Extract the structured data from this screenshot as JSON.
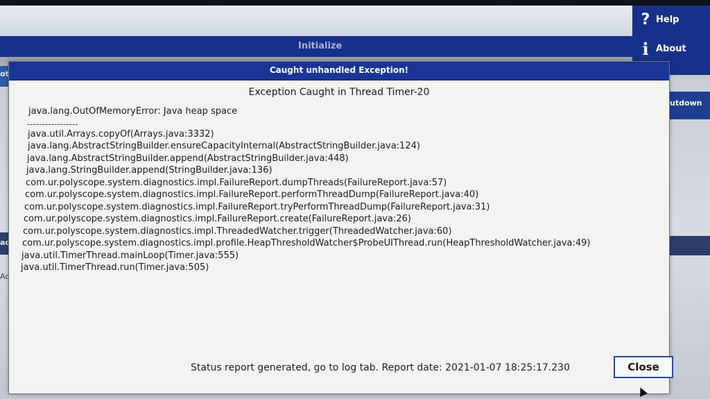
{
  "background": {
    "initialize_label": "Initialize",
    "left_fragment_top": "ot St",
    "left_fragment_mid": "ad",
    "left_fragment_low": "Act",
    "right_fragment": "utdown"
  },
  "right_panel": {
    "help_label": "Help",
    "about_label": "About"
  },
  "dialog": {
    "title": "Caught unhandled Exception!",
    "heading": "Exception Caught in Thread Timer-20",
    "error": "java.lang.OutOfMemoryError: Java heap space",
    "separator": "-----------------",
    "trace": [
      "java.util.Arrays.copyOf(Arrays.java:3332)",
      "java.lang.AbstractStringBuilder.ensureCapacityInternal(AbstractStringBuilder.java:124)",
      "java.lang.AbstractStringBuilder.append(AbstractStringBuilder.java:448)",
      "java.lang.StringBuilder.append(StringBuilder.java:136)",
      "com.ur.polyscope.system.diagnostics.impl.FailureReport.dumpThreads(FailureReport.java:57)",
      "com.ur.polyscope.system.diagnostics.impl.FailureReport.performThreadDump(FailureReport.java:40)",
      "com.ur.polyscope.system.diagnostics.impl.FailureReport.tryPerformThreadDump(FailureReport.java:31)",
      "com.ur.polyscope.system.diagnostics.impl.FailureReport.create(FailureReport.java:26)",
      "com.ur.polyscope.system.diagnostics.impl.ThreadedWatcher.trigger(ThreadedWatcher.java:60)",
      "com.ur.polyscope.system.diagnostics.impl.profile.HeapThresholdWatcher$ProbeUIThread.run(HeapThresholdWatcher.java:49)",
      "java.util.TimerThread.mainLoop(Timer.java:555)",
      "java.util.TimerThread.run(Timer.java:505)"
    ],
    "status": "Status report generated, go to log tab. Report date: 2021-01-07 18:25:17.230",
    "close_label": "Close"
  },
  "colors": {
    "title_bar": "#1a3596",
    "panel_blue": "#17318a",
    "dialog_bg": "#f3f4f2"
  },
  "icons": {
    "help": "question-mark-icon",
    "about": "info-icon",
    "cursor": "mouse-pointer-icon"
  }
}
